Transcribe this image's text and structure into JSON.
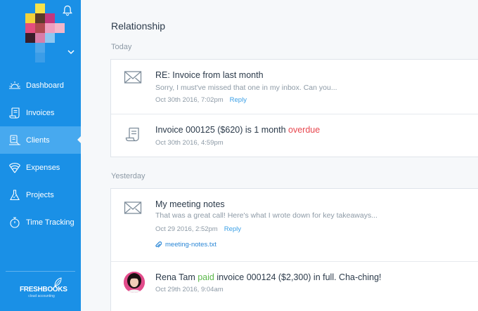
{
  "sidebar": {
    "nav": [
      {
        "label": "Dashboard",
        "icon": "sun-icon",
        "active": false
      },
      {
        "label": "Invoices",
        "icon": "scroll-icon",
        "active": false
      },
      {
        "label": "Clients",
        "icon": "client-icon",
        "active": true
      },
      {
        "label": "Expenses",
        "icon": "wifi-icon",
        "active": false
      },
      {
        "label": "Projects",
        "icon": "flask-icon",
        "active": false
      },
      {
        "label": "Time Tracking",
        "icon": "stopwatch-icon",
        "active": false
      }
    ],
    "logo": {
      "main": "FRESHBOOKS",
      "sub": "cloud accounting"
    },
    "colors": {
      "sidebar": "#1a90e6",
      "active": "#47a9ef"
    }
  },
  "main": {
    "title": "Relationship",
    "groups": [
      {
        "label": "Today",
        "entries": [
          {
            "icon": "envelope-icon",
            "title": "RE: Invoice from last month",
            "subtitle": "Sorry, I must've missed that one in my inbox. Can you...",
            "meta": "Oct 30th 2016, 7:02pm",
            "action": "Reply"
          },
          {
            "icon": "invoice-icon",
            "title_prefix": "Invoice 000125 ($620) is 1 month ",
            "title_status": "overdue",
            "meta": "Oct 30th 2016, 4:59pm"
          }
        ]
      },
      {
        "label": "Yesterday",
        "entries": [
          {
            "icon": "envelope-icon",
            "title": "My meeting notes",
            "subtitle": "That was a great call! Here's what I wrote down for key takeaways...",
            "meta": "Oct 29 2016, 2:52pm",
            "action": "Reply",
            "attachment": "meeting-notes.txt"
          },
          {
            "icon": "avatar",
            "title_name": "Rena Tam ",
            "title_status": "paid",
            "title_rest": " invoice 000124 ($2,300) in full. Cha-ching!",
            "meta": "Oct 29th 2016, 9:04am"
          }
        ]
      }
    ],
    "colors": {
      "overdue": "#e8474f",
      "paid": "#5bb84a",
      "link": "#3a9fe6"
    }
  }
}
